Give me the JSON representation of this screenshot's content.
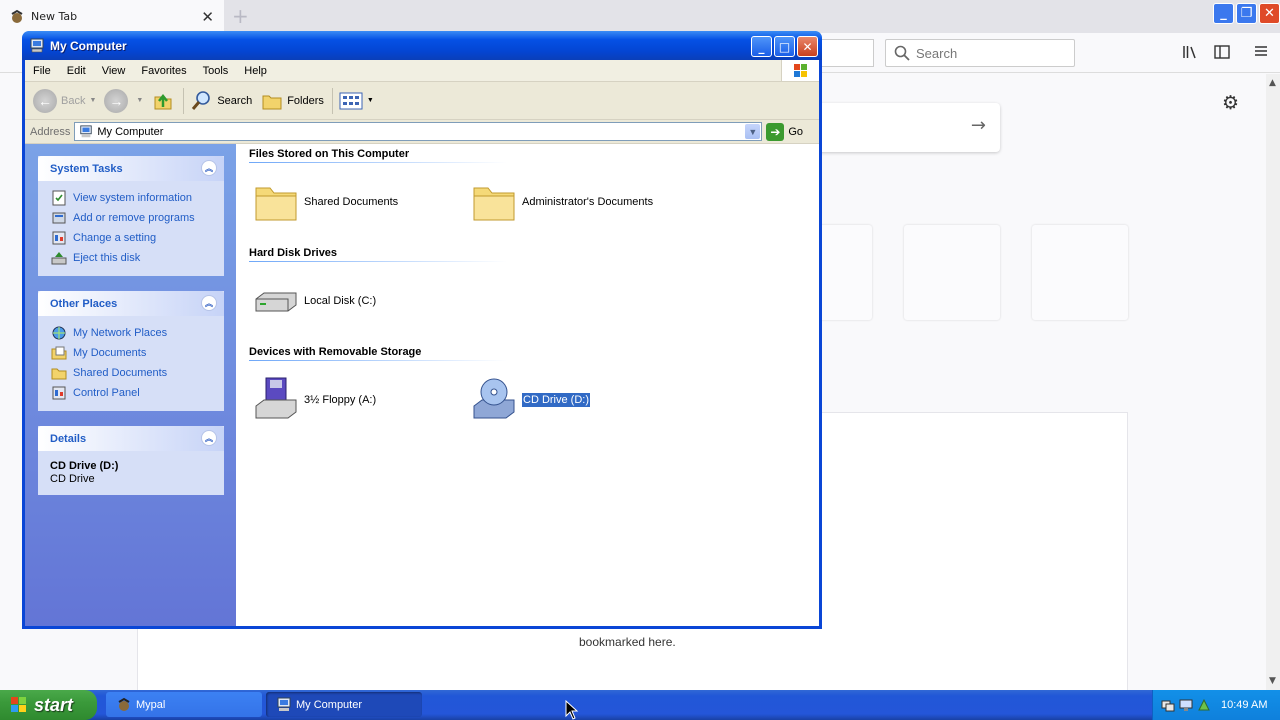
{
  "browser": {
    "tab_title": "New Tab",
    "tab_close": "✕",
    "new_tab": "+",
    "search_placeholder": "Search",
    "gear": "⚙",
    "arrow": "→",
    "bookmark_text": "bookmarked here."
  },
  "window": {
    "title": "My Computer",
    "menu": [
      "File",
      "Edit",
      "View",
      "Favorites",
      "Tools",
      "Help"
    ],
    "toolbar": {
      "back": "Back",
      "search": "Search",
      "folders": "Folders"
    },
    "address": {
      "label": "Address",
      "value": "My Computer",
      "go": "Go"
    },
    "panes": {
      "system_tasks": {
        "title": "System Tasks",
        "items": [
          "View system information",
          "Add or remove programs",
          "Change a setting",
          "Eject this disk"
        ]
      },
      "other_places": {
        "title": "Other Places",
        "items": [
          "My Network Places",
          "My Documents",
          "Shared Documents",
          "Control Panel"
        ]
      },
      "details": {
        "title": "Details",
        "name": "CD Drive (D:)",
        "type": "CD Drive"
      }
    },
    "groups": {
      "files": {
        "title": "Files Stored on This Computer",
        "items": [
          "Shared Documents",
          "Administrator's Documents"
        ]
      },
      "hdd": {
        "title": "Hard Disk Drives",
        "items": [
          "Local Disk (C:)"
        ]
      },
      "removable": {
        "title": "Devices with Removable Storage",
        "items": [
          "3½ Floppy (A:)",
          "CD Drive (D:)"
        ]
      }
    }
  },
  "taskbar": {
    "start": "start",
    "tasks": [
      "Mypal",
      "My Computer"
    ],
    "clock": "10:49 AM"
  },
  "colors": {
    "xp_blue": "#0a46d6",
    "link": "#215dc6",
    "selection": "#316ac5",
    "start_green": "#3b9a3b"
  }
}
